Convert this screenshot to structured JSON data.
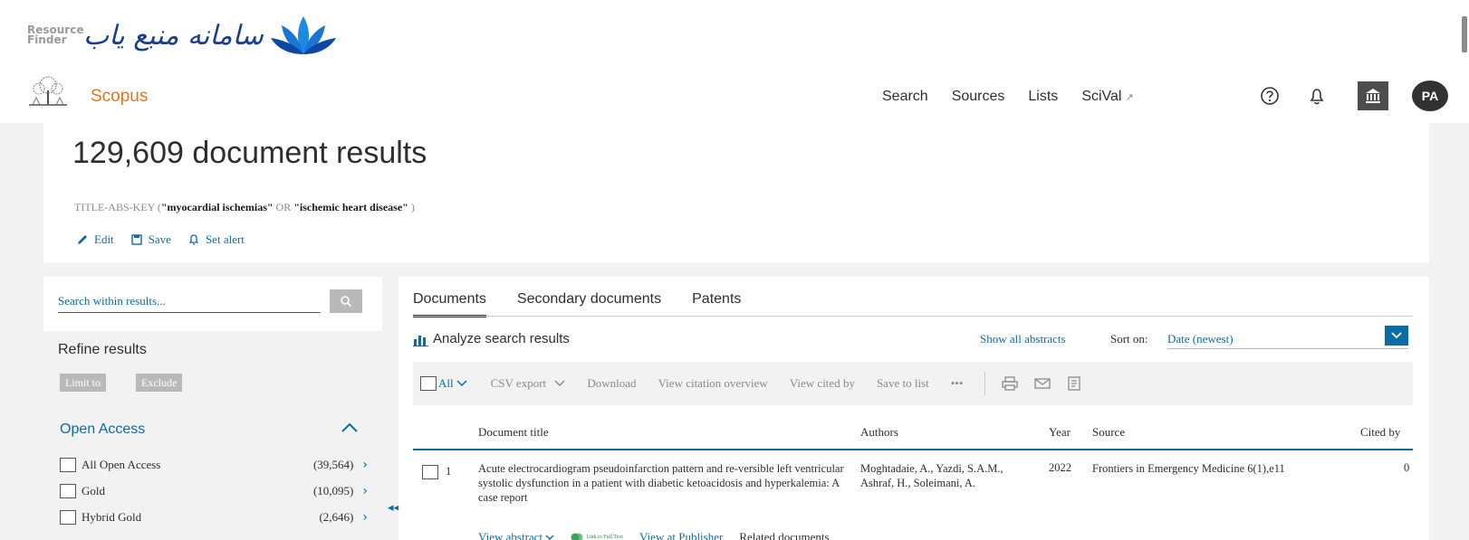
{
  "branding": {
    "resource_finder_text": "Resource Finder",
    "persian_name": "سامانه منبع یاب",
    "app_name": "Scopus"
  },
  "nav": {
    "search": "Search",
    "sources": "Sources",
    "lists": "Lists",
    "scival": "SciVal",
    "scival_ext": "↗",
    "avatar_initials": "PA"
  },
  "results": {
    "count_title": "129,609 document results",
    "query_prefix": "TITLE-ABS-KEY (",
    "query_term1": "\"myocardial ischemias\"",
    "query_or": " OR ",
    "query_term2": "\"ischemic heart disease\"",
    "query_suffix": " )",
    "edit": "Edit",
    "save": "Save",
    "set_alert": "Set alert"
  },
  "sidebar": {
    "search_placeholder": "Search within results...",
    "refine_title": "Refine results",
    "limit_to": "Limit to",
    "exclude": "Exclude",
    "facet_title": "Open Access",
    "facets": [
      {
        "label": "All Open Access",
        "count": "(39,564)"
      },
      {
        "label": "Gold",
        "count": "(10,095)"
      },
      {
        "label": "Hybrid Gold",
        "count": "(2,646)"
      }
    ]
  },
  "main": {
    "tabs": [
      "Documents",
      "Secondary documents",
      "Patents"
    ],
    "analyze": "Analyze search results",
    "show_all_abstracts": "Show all abstracts",
    "sort_on": "Sort on:",
    "sort_value": "Date (newest)",
    "toolbar": {
      "all": "All",
      "csv_export": "CSV export",
      "download": "Download",
      "view_citation_overview": "View citation overview",
      "view_cited_by": "View cited by",
      "save_to_list": "Save to list",
      "more": "•••"
    },
    "columns": {
      "title": "Document title",
      "authors": "Authors",
      "year": "Year",
      "source": "Source",
      "cited_by": "Cited by"
    },
    "rows": [
      {
        "num": "1",
        "title": "Acute electrocardiogram pseudoinfarction pattern and re-versible left ventricular systolic dysfunction in a patient with diabetic ketoacidosis and hyperkalemia: A case report",
        "authors": "Moghtadaie, A., Yazdi, S.A.M., Ashraf, H., Soleimani, A.",
        "year": "2022",
        "source": "Frontiers in Emergency Medicine 6(1),e11",
        "cited_by": "0"
      }
    ],
    "row_links": {
      "view_abstract": "View abstract",
      "link_full_text": "Link to Full Text",
      "view_at_publisher": "View at Publisher",
      "related_documents": "Related documents"
    }
  }
}
